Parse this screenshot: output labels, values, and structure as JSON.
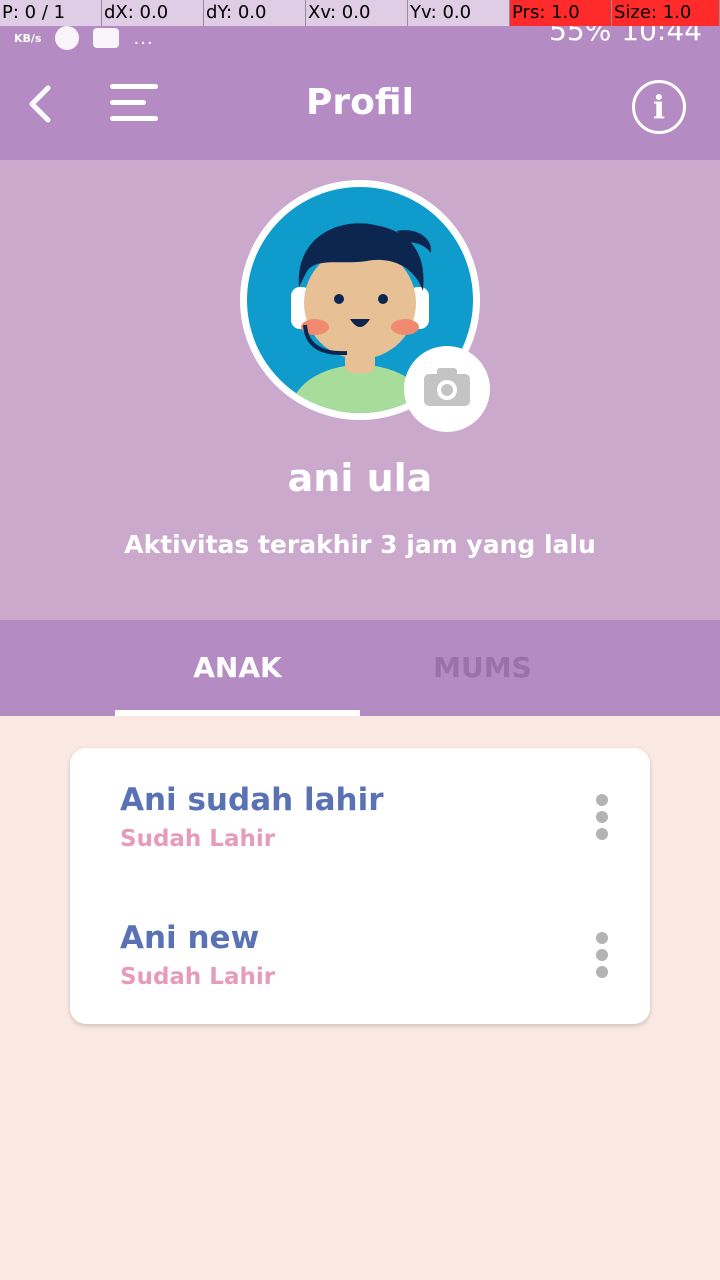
{
  "debug": {
    "pointer": "P: 0 / 1",
    "dx": "dX: 0.0",
    "dy": "dY: 0.0",
    "xv": "Xv: 0.0",
    "yv": "Yv: 0.0",
    "prs": "Prs: 1.0",
    "size": "Size: 1.0"
  },
  "status_bar": {
    "speed_unit": "KB/s",
    "dots": "...",
    "battery": "55%",
    "time": "10:44"
  },
  "header": {
    "title": "Profil",
    "info_label": "i",
    "back_icon": "chevron-left-icon",
    "menu_icon": "hamburger-menu-icon"
  },
  "profile": {
    "name": "ani ula",
    "last_activity": "Aktivitas terakhir 3 jam yang lalu",
    "camera_icon": "camera-icon"
  },
  "tabs": [
    {
      "label": "ANAK",
      "active": true
    },
    {
      "label": "MUMS",
      "active": false
    }
  ],
  "children": [
    {
      "name": "Ani sudah lahir",
      "status": "Sudah Lahir"
    },
    {
      "name": "Ani new",
      "status": "Sudah Lahir"
    }
  ],
  "colors": {
    "header": "#b48cc3",
    "profile_bg": "#caa9cd",
    "page_bg": "#fae8e2",
    "child_name": "#5872b4",
    "child_status": "#e79bbb"
  }
}
